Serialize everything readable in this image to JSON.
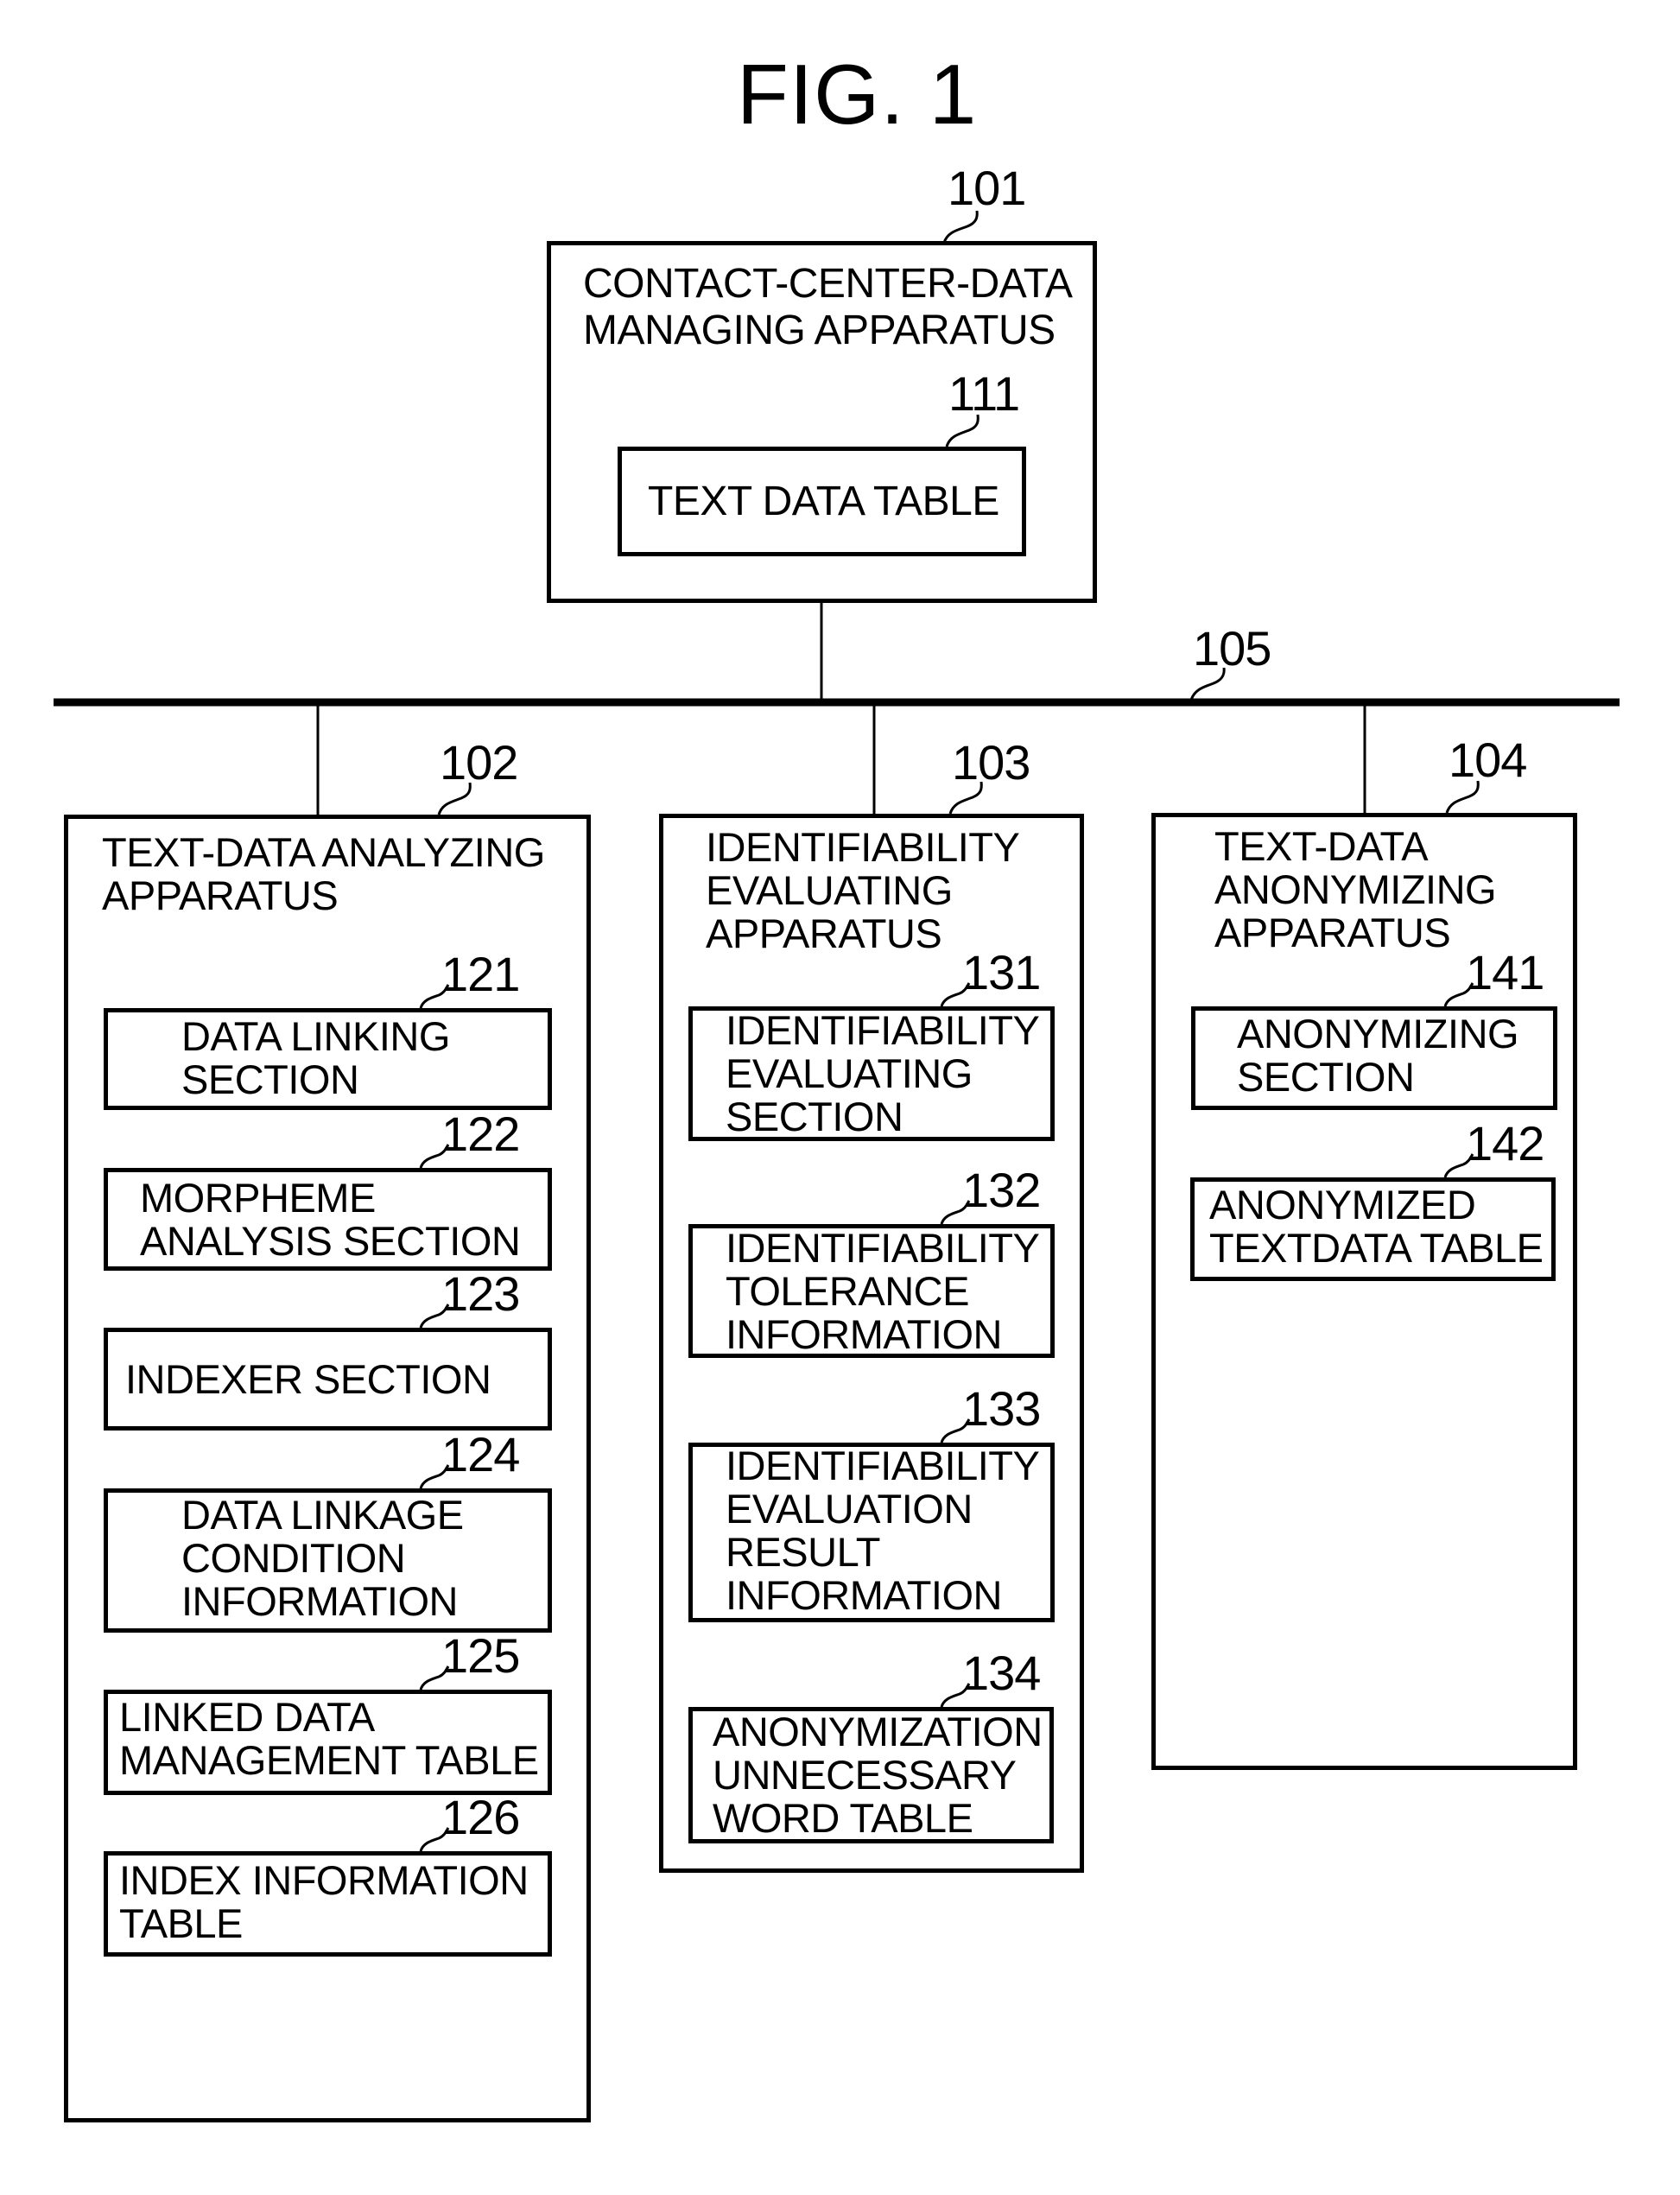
{
  "figure": {
    "title": "FIG. 1"
  },
  "network": {
    "ref": "105"
  },
  "apparatus": [
    {
      "id": "101",
      "ref": "101",
      "label": "CONTACT-CENTER-DATA\nMANAGING APPARATUS",
      "components": [
        {
          "ref": "111",
          "label": "TEXT DATA TABLE"
        }
      ]
    },
    {
      "id": "102",
      "ref": "102",
      "label": "TEXT-DATA ANALYZING\nAPPARATUS",
      "components": [
        {
          "ref": "121",
          "label": "DATA LINKING\nSECTION"
        },
        {
          "ref": "122",
          "label": "MORPHEME\nANALYSIS SECTION"
        },
        {
          "ref": "123",
          "label": "INDEXER SECTION"
        },
        {
          "ref": "124",
          "label": "DATA LINKAGE\nCONDITION\nINFORMATION"
        },
        {
          "ref": "125",
          "label": "LINKED DATA\nMANAGEMENT TABLE"
        },
        {
          "ref": "126",
          "label": "INDEX INFORMATION\nTABLE"
        }
      ]
    },
    {
      "id": "103",
      "ref": "103",
      "label": "IDENTIFIABILITY\nEVALUATING\nAPPARATUS",
      "components": [
        {
          "ref": "131",
          "label": "IDENTIFIABILITY\nEVALUATING\nSECTION"
        },
        {
          "ref": "132",
          "label": "IDENTIFIABILITY\nTOLERANCE\nINFORMATION"
        },
        {
          "ref": "133",
          "label": "IDENTIFIABILITY\nEVALUATION\nRESULT\nINFORMATION"
        },
        {
          "ref": "134",
          "label": "ANONYMIZATION\nUNNECESSARY\nWORD TABLE"
        }
      ]
    },
    {
      "id": "104",
      "ref": "104",
      "label": "TEXT-DATA\nANONYMIZING\nAPPARATUS",
      "components": [
        {
          "ref": "141",
          "label": "ANONYMIZING\nSECTION"
        },
        {
          "ref": "142",
          "label": "ANONYMIZED\nTEXTDATA TABLE"
        }
      ]
    }
  ]
}
